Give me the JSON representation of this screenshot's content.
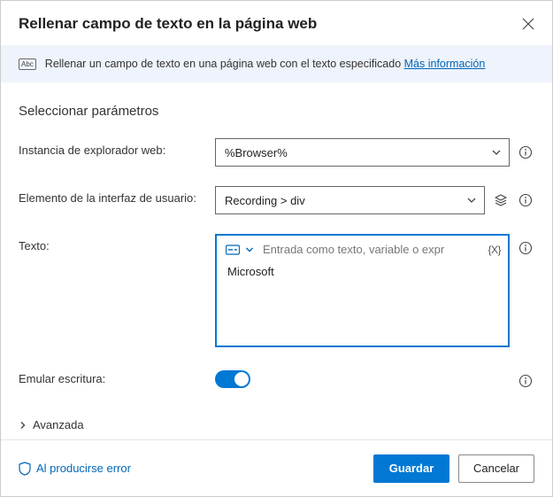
{
  "header": {
    "title": "Rellenar campo de texto en la página web"
  },
  "info": {
    "text": "Rellenar un campo de texto en una página web con el texto especificado",
    "link": "Más información"
  },
  "section_title": "Seleccionar parámetros",
  "fields": {
    "browser": {
      "label": "Instancia de explorador web:",
      "value": "%Browser%"
    },
    "element": {
      "label": "Elemento de la interfaz de usuario:",
      "value": "Recording > div"
    },
    "text": {
      "label": "Texto:",
      "placeholder": "Entrada como texto, variable o expr",
      "value": "Microsoft",
      "fx_label": "{X}"
    },
    "emulate": {
      "label": "Emular escritura:",
      "on": true
    },
    "advanced": "Avanzada"
  },
  "footer": {
    "on_error": "Al producirse error",
    "save": "Guardar",
    "cancel": "Cancelar"
  }
}
